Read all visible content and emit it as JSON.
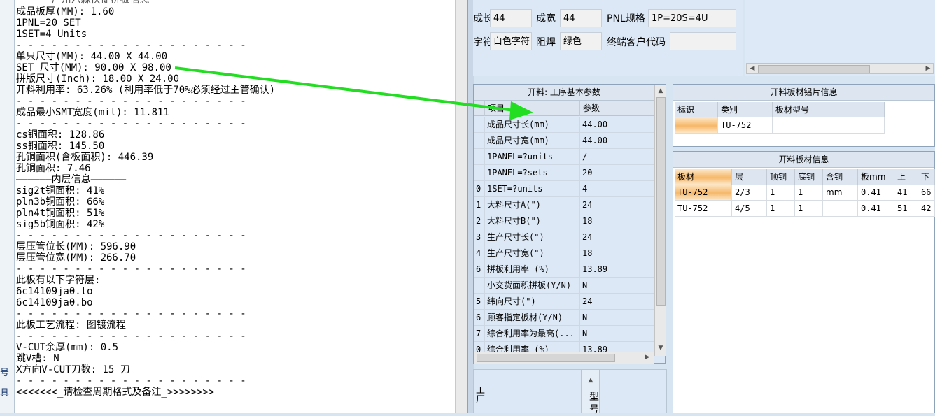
{
  "notepad": {
    "lines": [
      "成品板厚(MM): 1.60",
      "1PNL=20 SET",
      "1SET=4 Units",
      "- - - - - - - - - - - - - - - - - - - -",
      "单只尺寸(MM): 44.00 X 44.00",
      "SET 尺寸(MM): 90.00 X 98.00",
      "拼版尺寸(Inch): 18.00 X 24.00",
      "开料利用率: 63.26% (利用率低于70%必须经过主管确认)",
      "- - - - - - - - - - - - - - - - - - - -",
      "成品最小SMT宽度(mil): 11.811",
      "- - - - - - - - - - - - - - - - - - - -",
      "cs铜面积: 128.86",
      "ss铜面积: 145.50",
      "孔铜面积(含板面积): 446.39",
      "孔铜面积: 7.46",
      "——————内层信息——————",
      "sig2t铜面积: 41%",
      "pln3b铜面积: 66%",
      "pln4t铜面积: 51%",
      "sig5b铜面积: 42%",
      "- - - - - - - - - - - - - - - - - - - -",
      "层压管位长(MM): 596.90",
      "层压管位宽(MM): 266.70",
      "- - - - - - - - - - - - - - - - - - - -",
      "此板有以下字符层:",
      "6c14109ja0.to",
      "6c14109ja0.bo",
      "- - - - - - - - - - - - - - - - - - - -",
      "此板工艺流程: 图镀流程",
      "- - - - - - - - - - - - - - - - - - - -",
      "V-CUT余厚(mm): 0.5",
      "跳V槽: N",
      "X方向V-CUT刀数: 15 刀",
      "- - - - - - - - - - - - - - - - - - - -",
      "<<<<<<<_请检查周期格式及备注_>>>>>>>>"
    ],
    "sidebar_fragments": [
      "号",
      "具"
    ]
  },
  "top_form": {
    "len_label": "成长",
    "len_value": "44",
    "wid_label": "成宽",
    "wid_value": "44",
    "pnl_label": "PNL规格",
    "pnl_value": "1P=20S=4U",
    "char_label": "字符",
    "char_value": "白色字符",
    "mask_label": "阻焊",
    "mask_value": "绿色",
    "customer_label": "终端客户代码",
    "customer_value": ""
  },
  "params": {
    "title": "开料: 工序基本参数",
    "col_item": "项目",
    "col_value": "参数",
    "rows": [
      {
        "idx": "",
        "item": "成品尺寸长(mm)",
        "value": "44.00"
      },
      {
        "idx": "",
        "item": "成品尺寸宽(mm)",
        "value": "44.00"
      },
      {
        "idx": "",
        "item": "1PANEL=?units",
        "value": "/"
      },
      {
        "idx": "",
        "item": "1PANEL=?sets",
        "value": "20"
      },
      {
        "idx": "0",
        "item": "1SET=?units",
        "value": "4"
      },
      {
        "idx": "1",
        "item": "大料尺寸A(\")",
        "value": "24"
      },
      {
        "idx": "2",
        "item": "大料尺寸B(\")",
        "value": "18"
      },
      {
        "idx": "3",
        "item": "生产尺寸长(\")",
        "value": "24"
      },
      {
        "idx": "4",
        "item": "生产尺寸宽(\")",
        "value": "18"
      },
      {
        "idx": "6",
        "item": "拼板利用率 (%)",
        "value": "13.89"
      },
      {
        "idx": "",
        "item": "小交货面积拼板(Y/N)",
        "value": "N"
      },
      {
        "idx": "5",
        "item": "纬向尺寸(\")",
        "value": "24"
      },
      {
        "idx": "6",
        "item": "顾客指定板材(Y/N)",
        "value": "N"
      },
      {
        "idx": "7",
        "item": "综合利用率为最高(...",
        "value": "N"
      },
      {
        "idx": "0",
        "item": "综合利用率 (%)",
        "value": "13.89"
      }
    ]
  },
  "sheet_info": {
    "title": "开料板材铝片信息",
    "headers": [
      "标识",
      "类别",
      "板材型号"
    ],
    "rows": [
      [
        "",
        "TU-752",
        ""
      ]
    ]
  },
  "material_info": {
    "title": "开料板材信息",
    "headers": [
      "板材",
      "层",
      "顶铜",
      "底铜",
      "含铜mm",
      "板mm",
      "上",
      "下"
    ],
    "rows": [
      [
        "TU-752",
        "2/3",
        "1",
        "1",
        "",
        "0.41",
        "41",
        "66"
      ],
      [
        "TU-752",
        "4/5",
        "1",
        "1",
        "",
        "0.41",
        "51",
        "42"
      ]
    ]
  },
  "bottom": {
    "type_label": "型号",
    "left_fragment": "工厂"
  },
  "colors": {
    "arrow": "#22dd22",
    "highlight": "#f6b86a",
    "panel_bg": "#dce8f5"
  }
}
